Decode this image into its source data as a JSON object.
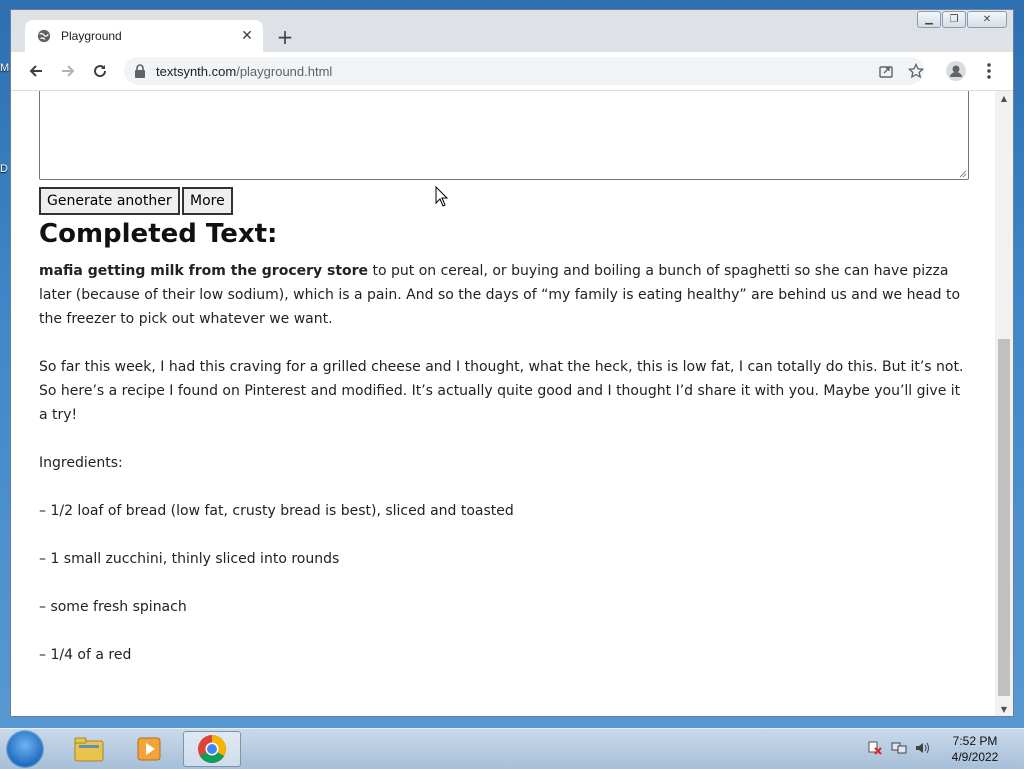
{
  "desktop": {
    "labels": [
      "M",
      "D"
    ]
  },
  "browser": {
    "tab": {
      "title": "Playground"
    },
    "address": {
      "domain": "textsynth.com",
      "path": "/playground.html"
    }
  },
  "page": {
    "buttons": {
      "generate_another": "Generate another",
      "more": "More"
    },
    "heading": "Completed Text:",
    "completion": {
      "prompt_bold": "mafia getting milk from the grocery store",
      "paragraph1_rest": " to put on cereal, or buying and boiling a bunch of spaghetti so she can have pizza later (because of their low sodium), which is a pain. And so the days of “my family is eating healthy” are behind us and we head to the freezer to pick out whatever we want.",
      "paragraph2": "So far this week, I had this craving for a grilled cheese and I thought, what the heck, this is low fat, I can totally do this. But it’s not. So here’s a recipe I found on Pinterest and modified. It’s actually quite good and I thought I’d share it with you. Maybe you’ll give it a try!",
      "ingredients_label": "Ingredients:",
      "items": [
        "– 1/2 loaf of bread (low fat, crusty bread is best), sliced and toasted",
        "– 1 small zucchini, thinly sliced into rounds",
        "– some fresh spinach",
        "– 1/4 of a red"
      ]
    }
  },
  "taskbar": {
    "time": "7:52 PM",
    "date": "4/9/2022"
  },
  "colors": {
    "desktop": "#3f87c8",
    "chrome_frame": "#dee1e6",
    "taskbar": "#b8cce2"
  }
}
